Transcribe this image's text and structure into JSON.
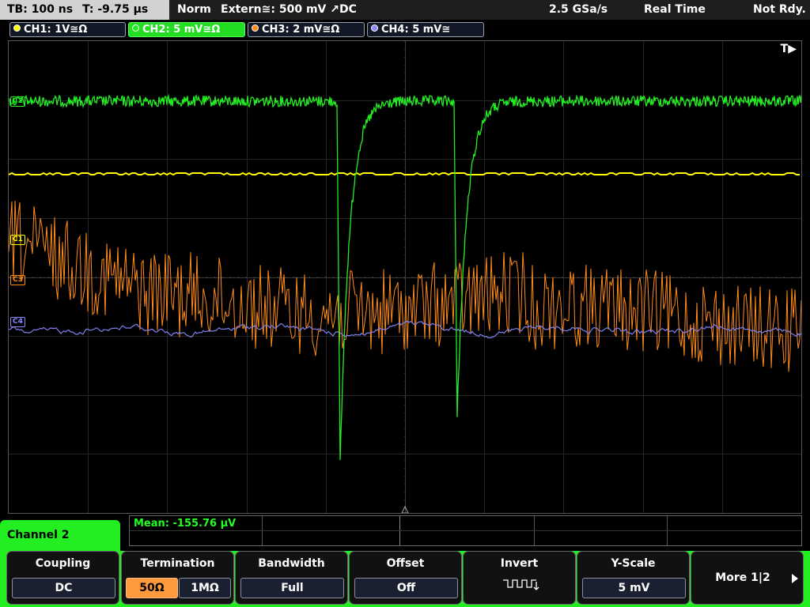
{
  "topbar": {
    "timebase": "TB: 100 ns",
    "trigger_time": "T: -9.75 µs",
    "mode": "Norm",
    "trigger_source": "Extern≅: 500 mV ↗DC",
    "sample_rate": "2.5 GSa/s",
    "acq_mode": "Real Time",
    "status": "Not Rdy."
  },
  "channels": [
    {
      "label": "CH1: 1V≅Ω",
      "color": "#ffff00",
      "active": false
    },
    {
      "label": "CH2: 5 mV≅Ω",
      "color": "#22ee22",
      "active": true
    },
    {
      "label": "CH3: 2 mV≅Ω",
      "color": "#ff8c1a",
      "active": false
    },
    {
      "label": "CH4: 5 mV≅",
      "color": "#8888ff",
      "active": false
    }
  ],
  "screen": {
    "trigger_marker": "T▶",
    "markers": {
      "c1": "C1",
      "c2": "C2",
      "c3": "C3",
      "c4": "C4"
    },
    "icons": {
      "trigger_arrow": "trigger-position-arrow-icon"
    }
  },
  "measurement": {
    "label": "Mean: -155.76 µV"
  },
  "menu": {
    "channel_tab": "Channel 2",
    "coupling": {
      "title": "Coupling",
      "value": "DC"
    },
    "termination": {
      "title": "Termination",
      "opt1": "50Ω",
      "opt2": "1MΩ"
    },
    "bandwidth": {
      "title": "Bandwidth",
      "value": "Full"
    },
    "offset": {
      "title": "Offset",
      "value": "Off"
    },
    "invert": {
      "title": "Invert",
      "icon": "square-wave-icon"
    },
    "yscale": {
      "title": "Y-Scale",
      "value": "5 mV"
    },
    "more": {
      "label": "More 1|2",
      "icon": "arrow-right-icon"
    }
  }
}
